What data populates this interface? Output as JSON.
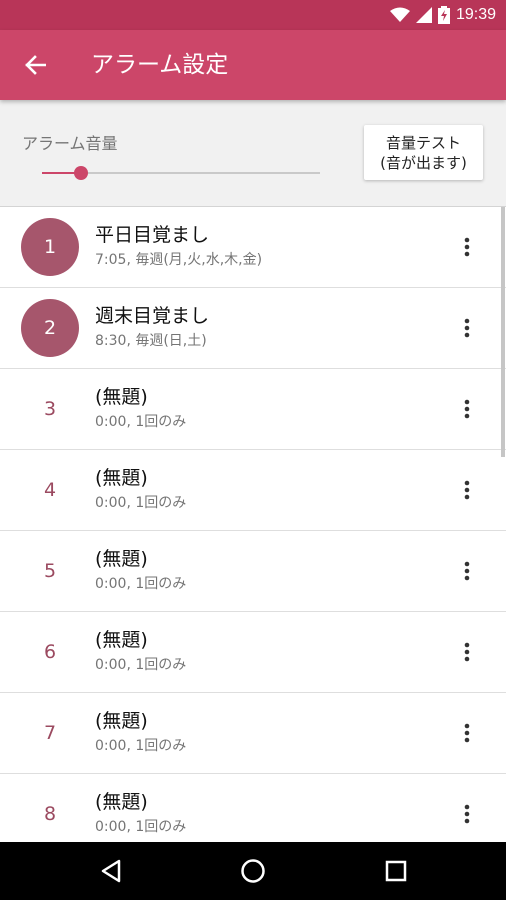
{
  "status_bar": {
    "time": "19:39",
    "icons": [
      "wifi-icon",
      "signal-icon",
      "battery-icon"
    ]
  },
  "app_bar": {
    "title": "アラーム設定",
    "back_icon": "arrow-left-icon"
  },
  "volume": {
    "label": "アラーム音量",
    "level": 0.14,
    "test_button": {
      "line1": "音量テスト",
      "line2": "(音が出ます)"
    }
  },
  "alarms": [
    {
      "number": "1",
      "title": "平日目覚まし",
      "detail": "7:05, 毎週(月,火,水,木,金)",
      "active": true
    },
    {
      "number": "2",
      "title": "週末目覚まし",
      "detail": "8:30, 毎週(日,土)",
      "active": true
    },
    {
      "number": "3",
      "title": "(無題)",
      "detail": "0:00, 1回のみ",
      "active": false
    },
    {
      "number": "4",
      "title": "(無題)",
      "detail": "0:00, 1回のみ",
      "active": false
    },
    {
      "number": "5",
      "title": "(無題)",
      "detail": "0:00, 1回のみ",
      "active": false
    },
    {
      "number": "6",
      "title": "(無題)",
      "detail": "0:00, 1回のみ",
      "active": false
    },
    {
      "number": "7",
      "title": "(無題)",
      "detail": "0:00, 1回のみ",
      "active": false
    },
    {
      "number": "8",
      "title": "(無題)",
      "detail": "0:00, 1回のみ",
      "active": false
    }
  ],
  "nav_bar": {
    "icons": [
      "back-triangle-icon",
      "home-circle-icon",
      "recents-square-icon"
    ]
  },
  "colors": {
    "status_bar": "#b83558",
    "app_bar": "#cc4669",
    "active_badge": "#a6566c",
    "inactive_number": "#9b4a60"
  }
}
